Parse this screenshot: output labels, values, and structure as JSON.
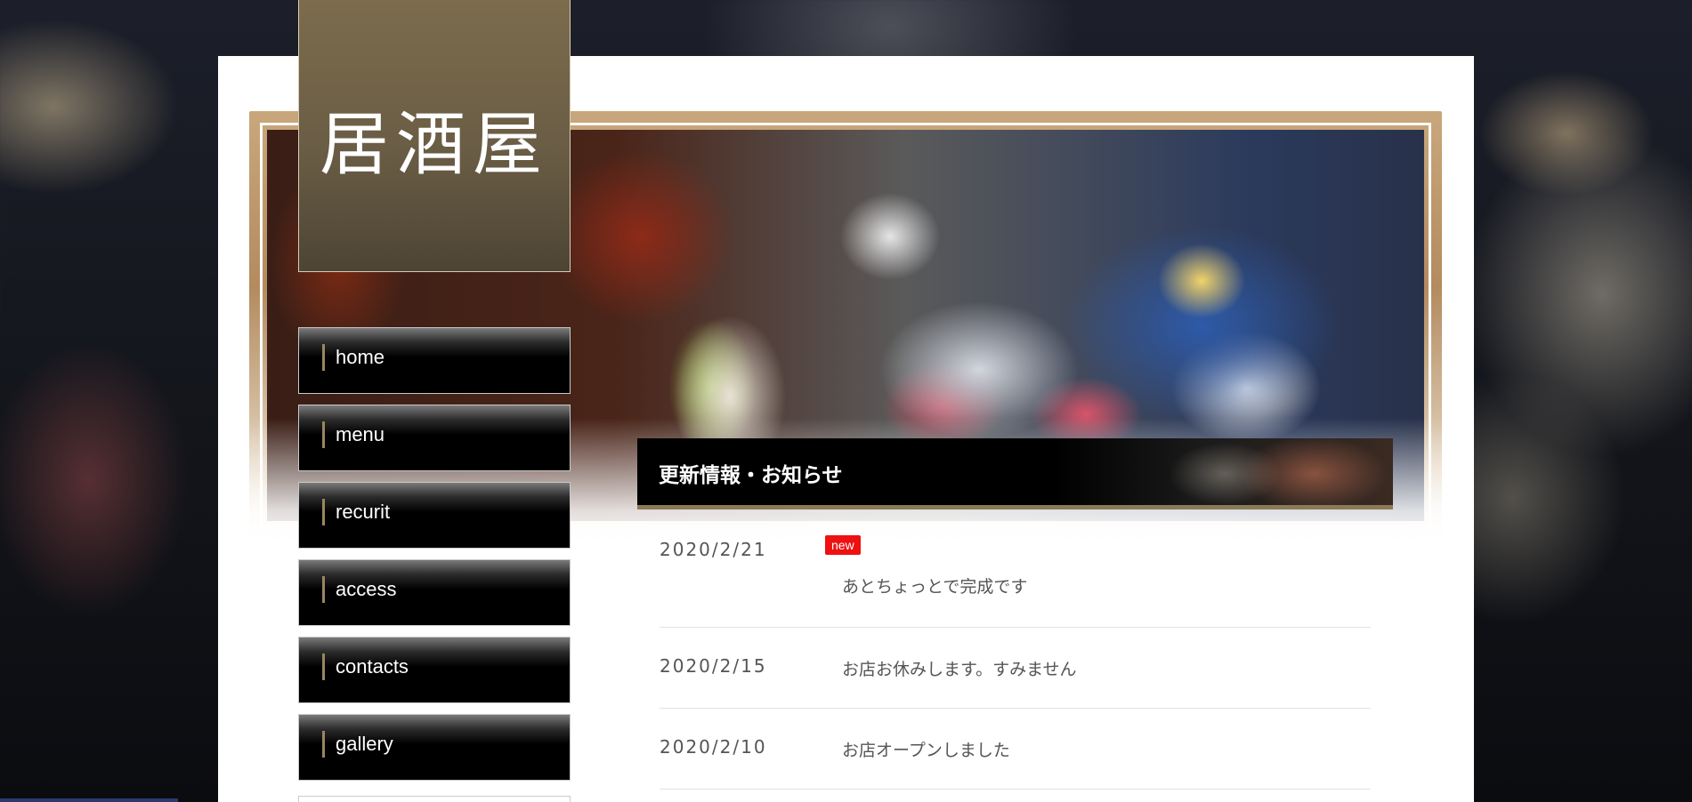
{
  "site": {
    "logo_text": "居酒屋"
  },
  "nav": {
    "items": [
      {
        "label": "home"
      },
      {
        "label": "menu"
      },
      {
        "label": "recurit"
      },
      {
        "label": "access"
      },
      {
        "label": "contacts"
      },
      {
        "label": "gallery"
      }
    ]
  },
  "news": {
    "title": "更新情報・お知らせ",
    "badge": "new",
    "items": [
      {
        "date": "2020/2/21",
        "text": "あとちょっとで完成です",
        "is_new": true
      },
      {
        "date": "2020/2/15",
        "text": "お店お休みします。すみません",
        "is_new": false
      },
      {
        "date": "2020/2/10",
        "text": "お店オープンしました",
        "is_new": false
      }
    ]
  },
  "colors": {
    "logo_bg": "#6a5d45",
    "accent_bar": "#9a8560",
    "badge_red": "#ee1111",
    "header_underline": "#8a7a55"
  }
}
